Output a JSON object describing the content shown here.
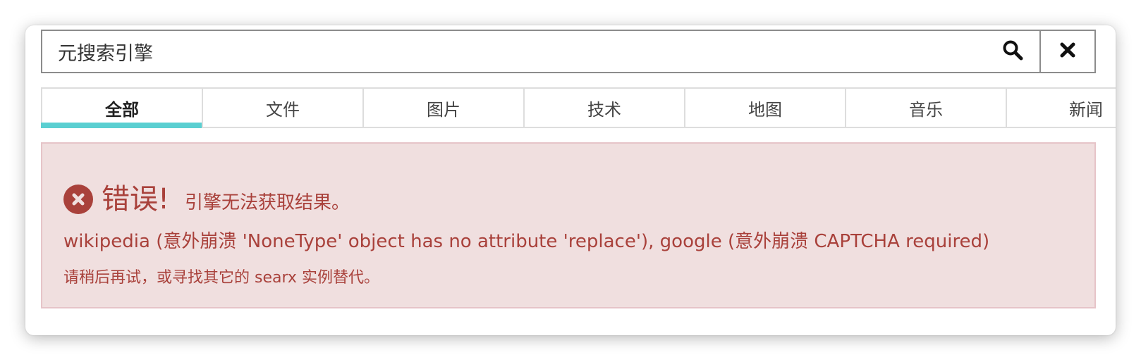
{
  "search": {
    "value": "元搜索引擎",
    "placeholder": ""
  },
  "tabs": [
    {
      "label": "全部",
      "active": true
    },
    {
      "label": "文件",
      "active": false
    },
    {
      "label": "图片",
      "active": false
    },
    {
      "label": "技术",
      "active": false
    },
    {
      "label": "地图",
      "active": false
    },
    {
      "label": "音乐",
      "active": false
    },
    {
      "label": "新闻",
      "active": false
    }
  ],
  "alert": {
    "title": "错误!",
    "subtitle": "引擎无法获取结果。",
    "detail": "wikipedia (意外崩溃 'NoneType' object has no attribute 'replace'), google (意外崩溃 CAPTCHA required)",
    "hint": "请稍后再试，或寻找其它的 searx 实例替代。"
  },
  "icons": {
    "search": "search-icon",
    "clear": "close-icon",
    "alert": "error-circle-icon"
  },
  "colors": {
    "accent": "#5acfd1",
    "alert_text": "#a9413b",
    "alert_bg": "#f0dfdf",
    "alert_border": "#e6c4c8"
  }
}
